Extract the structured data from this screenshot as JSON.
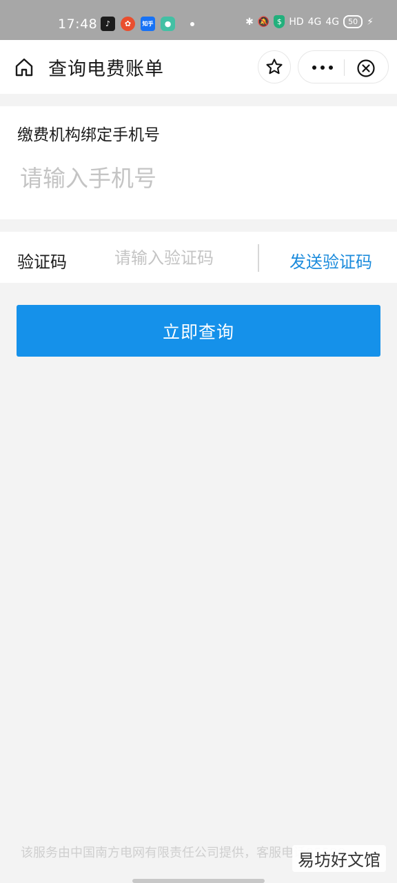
{
  "status_bar": {
    "time": "17:48",
    "apps": [
      "tiktok-icon",
      "news-icon",
      "zhihu-icon",
      "app-icon"
    ],
    "zhihu_label": "知乎",
    "network_label": "HD",
    "signal_1": "4G",
    "signal_2": "4G",
    "battery": "50"
  },
  "nav": {
    "title": "查询电费账单"
  },
  "phone": {
    "label": "缴费机构绑定手机号",
    "placeholder": "请输入手机号",
    "value": ""
  },
  "verification": {
    "label": "验证码",
    "placeholder": "请输入验证码",
    "value": "",
    "send_label": "发送验证码"
  },
  "actions": {
    "query_label": "立即查询"
  },
  "footer": {
    "text": "该服务由中国南方电网有限责任公司提供，客服电话95598",
    "watermark": "易坊好文馆"
  },
  "colors": {
    "primary": "#1591ea",
    "link": "#1b8bdc",
    "status_bar": "#a7a7a7",
    "page_bg": "#f3f3f3"
  }
}
